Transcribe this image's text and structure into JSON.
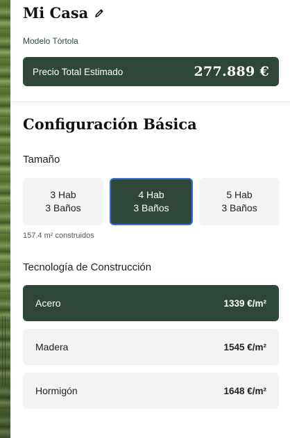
{
  "header": {
    "title": "Mi Casa",
    "model": "Modelo Tórtola"
  },
  "price": {
    "label": "Precio Total Estimado",
    "value": "277.889 €"
  },
  "config": {
    "section_title": "Configuración Básica",
    "size_heading": "Tamaño",
    "size_options": [
      {
        "rooms": "3 Hab",
        "baths": "3 Baños",
        "selected": false
      },
      {
        "rooms": "4 Hab",
        "baths": "3 Baños",
        "selected": true
      },
      {
        "rooms": "5 Hab",
        "baths": "3 Baños",
        "selected": false
      }
    ],
    "area_note": "157.4 m² construidos",
    "tech_heading": "Tecnología de Construcción",
    "tech_options": [
      {
        "name": "Acero",
        "price": "1339 €/m²",
        "selected": true
      },
      {
        "name": "Madera",
        "price": "1545 €/m²",
        "selected": false
      },
      {
        "name": "Hormigón",
        "price": "1648 €/m²",
        "selected": false
      }
    ]
  },
  "colors": {
    "accent_dark_green": "#2f4739",
    "selection_outline": "#3a6fd8",
    "card_background": "#f3f3f3"
  },
  "icons": {
    "edit": "pencil-icon"
  }
}
